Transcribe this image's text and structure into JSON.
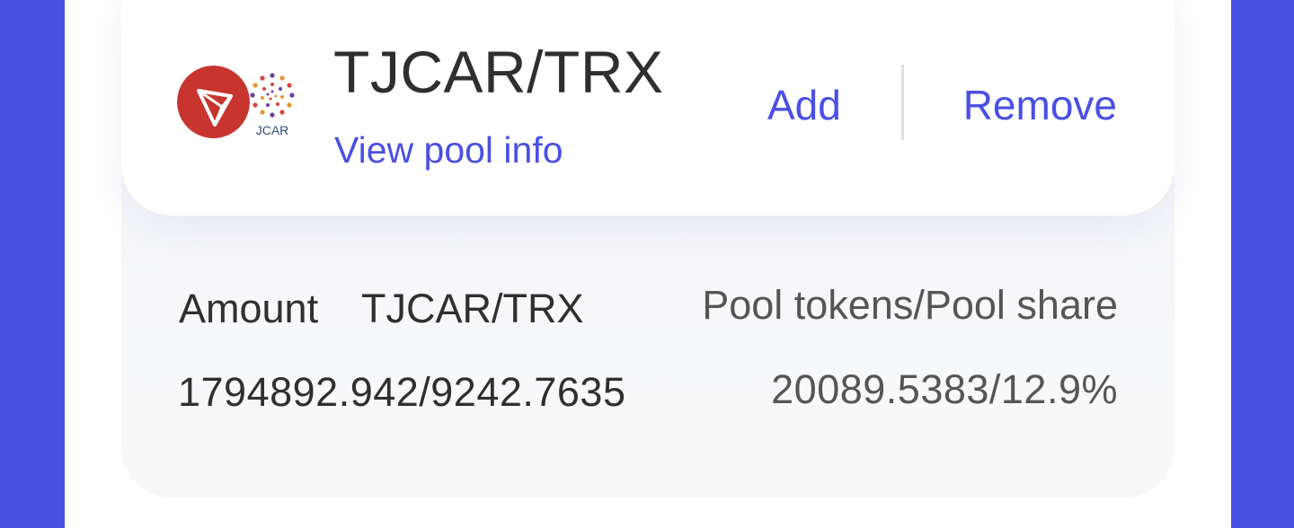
{
  "pool": {
    "pair": "TJCAR/TRX",
    "view_pool_info": "View pool info",
    "add_label": "Add",
    "remove_label": "Remove",
    "token_a_icon": "tron-icon",
    "token_b_icon": "jcar-icon",
    "token_b_logo_text": "JCAR"
  },
  "details": {
    "amount_label": "Amount",
    "pair_label": "TJCAR/TRX",
    "pool_label": "Pool tokens/Pool share",
    "amount_value": "1794892.942/9242.7635",
    "pool_value": "20089.5383/12.9%"
  },
  "colors": {
    "accent": "#4a4fe4",
    "tron_red": "#c8352e",
    "text_dark": "#2f2f2f",
    "text_muted": "#555555"
  }
}
